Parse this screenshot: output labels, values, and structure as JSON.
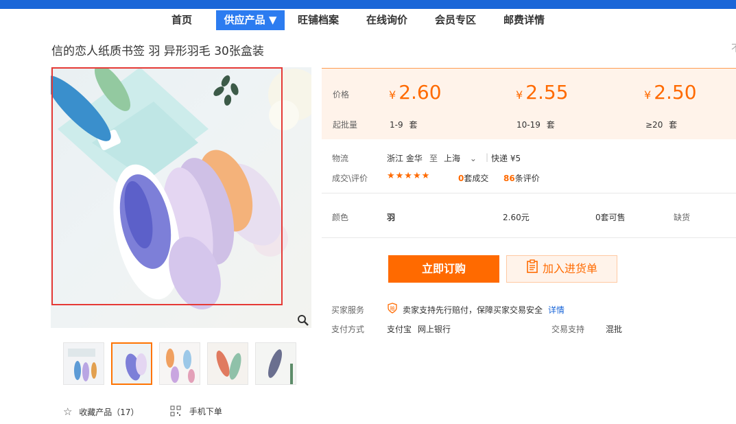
{
  "nav": {
    "items": [
      "首页",
      "供应产品 ▼",
      "旺铺档案",
      "在线询价",
      "会员专区",
      "邮费详情"
    ]
  },
  "product": {
    "title": "信的恋人纸质书签 羽 异形羽毛 30张盒装",
    "right_edge_char": "不"
  },
  "gallery": {
    "zoom_icon": "magnifier-icon",
    "favorite_label": "收藏产品（17）",
    "mobile_order_label": "手机下单"
  },
  "pricing": {
    "price_label": "价格",
    "moq_label": "起批量",
    "currency": "¥",
    "tiers": [
      {
        "price": "2.60",
        "range": "1-9",
        "unit": "套"
      },
      {
        "price": "2.55",
        "range": "10-19",
        "unit": "套"
      },
      {
        "price": "2.50",
        "range": "≥20",
        "unit": "套"
      }
    ]
  },
  "logistics": {
    "label": "物流",
    "from": "浙江 金华",
    "to_word": "至",
    "to": "上海",
    "shipping": "快递 ¥5"
  },
  "deals": {
    "label": "成交\\评价",
    "stars": "★★★★★",
    "deal_count": "0",
    "deal_suffix": "套成交",
    "review_count": "86",
    "review_suffix": "条评价"
  },
  "variant": {
    "label": "颜色",
    "name": "羽",
    "price": "2.60元",
    "available_count": "0",
    "available_suffix": "套可售",
    "status": "缺货"
  },
  "actions": {
    "buy": "立即订购",
    "cart": "加入进货单"
  },
  "service": {
    "label": "买家服务",
    "text": "卖家支持先行赔付，保障买家交易安全",
    "link": "详情"
  },
  "payment": {
    "label": "支付方式",
    "methods": [
      "支付宝",
      "网上银行"
    ],
    "trade_label": "交易支持",
    "trade_value": "混批"
  },
  "colors": {
    "accent": "#ff6a00",
    "nav_blue": "#1a66d8",
    "active_tab": "#2c7cf0",
    "price_bg": "#fff3ea",
    "frame_red": "#e53935"
  }
}
